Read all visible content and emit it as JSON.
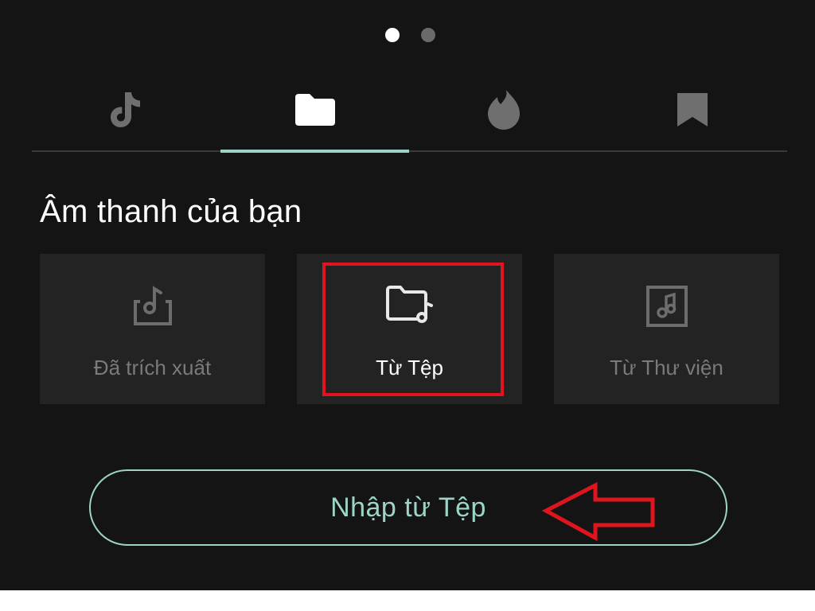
{
  "pager": {
    "dots": [
      "active",
      "inactive"
    ]
  },
  "tabs": [
    {
      "icon": "tiktok-logo-icon",
      "active": false
    },
    {
      "icon": "folder-icon",
      "active": true
    },
    {
      "icon": "flame-icon",
      "active": false
    },
    {
      "icon": "bookmark-icon",
      "active": false
    }
  ],
  "section": {
    "title": "Âm thanh của bạn"
  },
  "cards": [
    {
      "label": "Đã trích xuất",
      "icon": "extract-music-icon"
    },
    {
      "label": "Từ Tệp",
      "icon": "folder-music-icon"
    },
    {
      "label": "Từ Thư viện",
      "icon": "music-library-icon"
    }
  ],
  "import_button": {
    "label": "Nhập từ Tệp"
  },
  "colors": {
    "background": "#141414",
    "card": "#232323",
    "accent": "#9ed4c8",
    "annotation_red": "#e0141e"
  }
}
